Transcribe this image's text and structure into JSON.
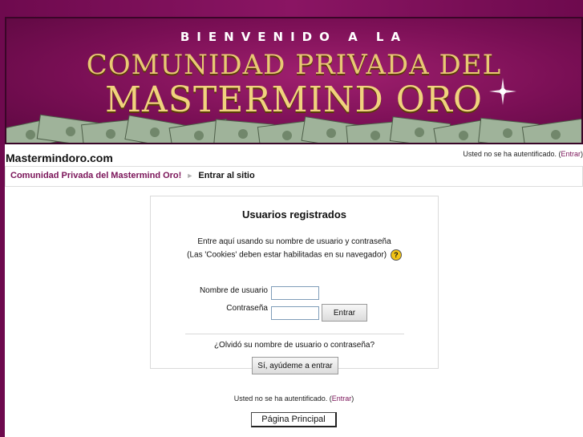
{
  "banner": {
    "welcome": "BIENVENIDO A LA",
    "line1": "COMUNIDAD PRIVADA DEL",
    "line2": "MASTERMIND ORO"
  },
  "header": {
    "site_name": "Mastermindoro.com",
    "login_status_text": "Usted no se ha autentificado. (",
    "login_link": "Entrar",
    "login_status_end": ")"
  },
  "breadcrumb": {
    "home": "Comunidad Privada del Mastermind Oro!",
    "separator": "►",
    "current": "Entrar al sitio"
  },
  "login": {
    "title": "Usuarios registrados",
    "intro_line1": "Entre aquí usando su nombre de usuario y contraseña",
    "intro_line2": "(Las 'Cookies' deben estar habilitadas en su navegador)",
    "help_symbol": "?",
    "username_label": "Nombre de usuario",
    "username_value": "",
    "password_label": "Contraseña",
    "password_value": "",
    "submit_label": "Entrar",
    "forgot_text": "¿Olvidó su nombre de usuario o contraseña?",
    "forgot_button": "Sí, ayúdeme a entrar"
  },
  "footer": {
    "login_status_text": "Usted no se ha autentificado. (",
    "login_link": "Entrar",
    "login_status_end": ")",
    "home_button": "Página Principal"
  },
  "colors": {
    "background": "#7a0f55",
    "link": "#7a1358",
    "gold": "#e9c874"
  },
  "icons": {
    "help": "help-icon",
    "sparkle": "sparkle-icon",
    "money": "money-stack-image"
  }
}
